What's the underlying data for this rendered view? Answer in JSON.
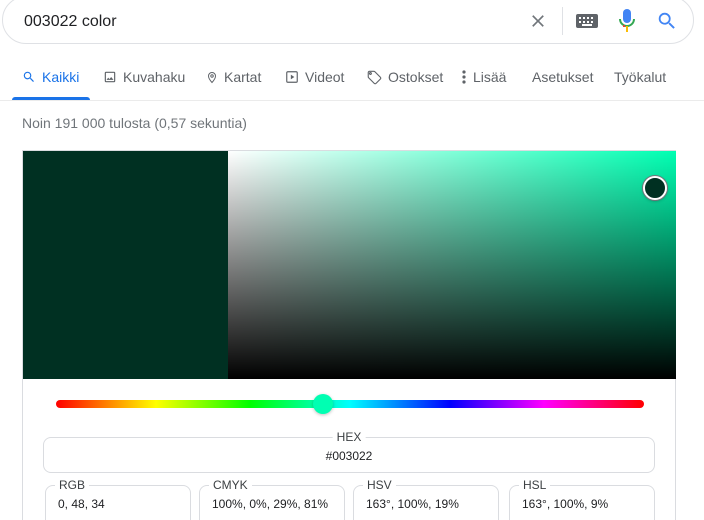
{
  "search": {
    "query": "003022 color",
    "icons": [
      "close-icon",
      "keyboard-icon",
      "mic-icon",
      "search-icon"
    ]
  },
  "tabs": [
    {
      "label": "Kaikki",
      "icon": "search-icon",
      "active": true
    },
    {
      "label": "Kuvahaku",
      "icon": "image-icon",
      "active": false
    },
    {
      "label": "Kartat",
      "icon": "map-pin-icon",
      "active": false
    },
    {
      "label": "Videot",
      "icon": "play-icon",
      "active": false
    },
    {
      "label": "Ostokset",
      "icon": "tag-icon",
      "active": false
    },
    {
      "label": "Lisää",
      "icon": "more-vert-icon",
      "active": false
    },
    {
      "label": "Asetukset",
      "active": false
    },
    {
      "label": "Työkalut",
      "active": false
    }
  ],
  "result_stats": "Noin 191 000 tulosta (0,57 sekuntia)",
  "picker": {
    "swatch_color": "#003022",
    "hue_color": "#00ffb2",
    "hue_position": 0.453,
    "saturation": 1.0,
    "value": 0.19,
    "hex": {
      "label": "HEX",
      "value": "#003022"
    },
    "rgb": {
      "label": "RGB",
      "value": "0, 48, 34"
    },
    "cmyk": {
      "label": "CMYK",
      "value": "100%, 0%, 29%, 81%"
    },
    "hsv": {
      "label": "HSV",
      "value": "163°, 100%, 19%"
    },
    "hsl": {
      "label": "HSL",
      "value": "163°, 100%, 9%"
    }
  },
  "colors": {
    "accent": "#1a73e8",
    "muted_text": "#70757a",
    "border": "#dadce0"
  }
}
